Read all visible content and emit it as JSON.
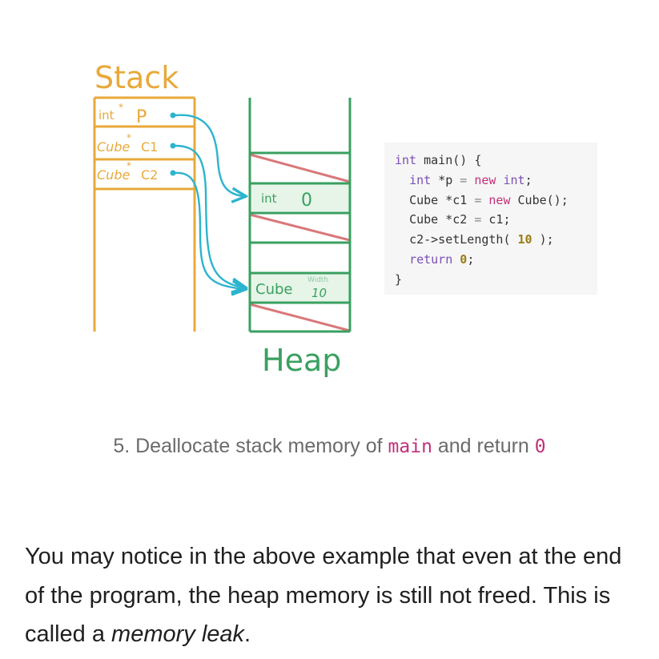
{
  "diagram": {
    "stack_title": "Stack",
    "heap_title": "Heap",
    "stack_rows": [
      {
        "type": "int",
        "star": "*",
        "name": "P"
      },
      {
        "type": "Cube",
        "star": "*",
        "name": "C1"
      },
      {
        "type": "Cube",
        "star": "*",
        "name": "C2"
      }
    ],
    "heap_int_label": "int",
    "heap_int_value": "0",
    "heap_cube_label": "Cube",
    "heap_cube_field": "Width",
    "heap_cube_value": "10",
    "colors": {
      "stack": "#e8a93a",
      "heap": "#3aa060",
      "arrow": "#2cb4cf",
      "free": "#d9787a",
      "allocated_fill": "#e6f5e8"
    }
  },
  "code": {
    "line1_kw": "int",
    "line1_fn": "main() {",
    "line2_kw": "int",
    "line2_a": "*p",
    "line2_eq": "=",
    "line2_new": "new",
    "line2_type": "int",
    "line2_end": ";",
    "line3_a": "Cube *c1",
    "line3_eq": "=",
    "line3_new": "new",
    "line3_end": "Cube();",
    "line4_a": "Cube *c2",
    "line4_eq": "=",
    "line4_end": "c1;",
    "line5_a": "c2->setLength(",
    "line5_num": "10",
    "line5_end": ");",
    "line6_kw": "return",
    "line6_num": "0",
    "line6_end": ";",
    "line7": "}"
  },
  "caption": {
    "prefix": "5. Deallocate stack memory of",
    "code1": "main",
    "middle": "and return",
    "code2": "0"
  },
  "paragraph": {
    "text": "You may notice in the above example that even at the end of the program, the heap memory is still not freed. This is called a",
    "emphasis": "memory leak",
    "end": "."
  }
}
